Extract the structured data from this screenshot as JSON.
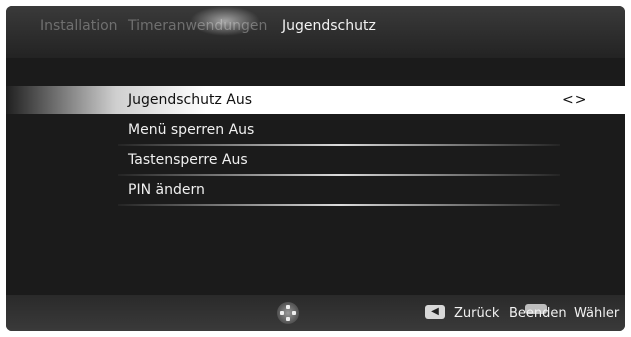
{
  "header": {
    "tabs": [
      {
        "label": "Installation",
        "active": false
      },
      {
        "label": "Timeranwendungen",
        "active": false
      },
      {
        "label": "Jugendschutz",
        "active": true
      }
    ]
  },
  "menu": {
    "items": [
      {
        "label": "Jugendschutz Aus",
        "selected": true
      },
      {
        "label": "Menü sperren Aus",
        "selected": false
      },
      {
        "label": "Tastensperre Aus",
        "selected": false
      },
      {
        "label": "PIN ändern",
        "selected": false
      }
    ],
    "selected_arrows": "<>"
  },
  "footer": {
    "back_label": "Zurück",
    "exit_label": "Beenden",
    "choose_label": "Wähler",
    "icons": [
      "navigation-pad-icon",
      "back-key-icon",
      "exit-key-icon"
    ]
  }
}
